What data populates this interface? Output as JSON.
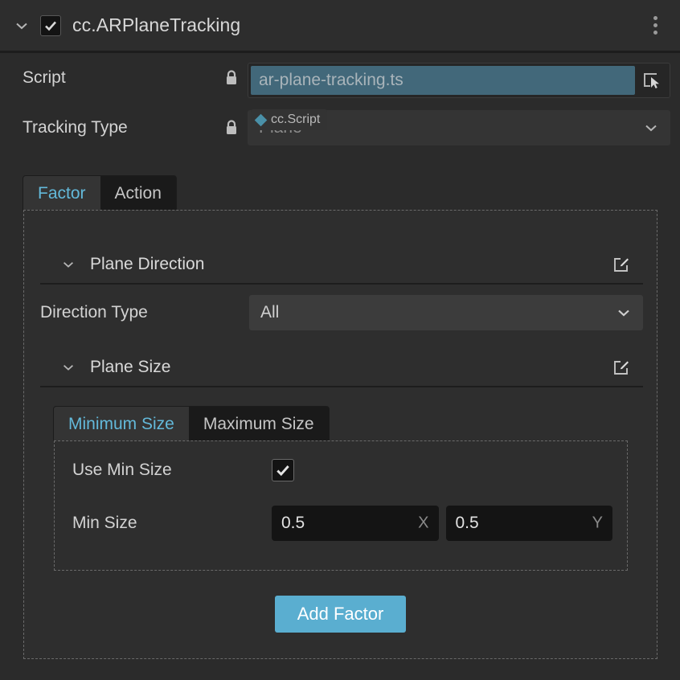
{
  "component": {
    "title": "cc.ARPlaneTracking",
    "enabled_checkbox": "checked",
    "collapse_icon": "chevron-down-icon",
    "menu_icon": "kebab-menu-icon"
  },
  "properties": {
    "script": {
      "label": "Script",
      "lock_icon": "lock-icon",
      "value": "ar-plane-tracking.ts",
      "type_tag": "cc.Script",
      "type_tag_icon": "diamond-icon",
      "pick_icon": "select-node-icon"
    },
    "tracking_type": {
      "label": "Tracking Type",
      "lock_icon": "lock-icon",
      "value": "Plane",
      "caret_icon": "chevron-down-icon"
    }
  },
  "main_tabs": {
    "active": "Factor",
    "items": [
      {
        "label": "Factor",
        "active": true
      },
      {
        "label": "Action",
        "active": false
      }
    ]
  },
  "factor_panel": {
    "plane_direction": {
      "title": "Plane Direction",
      "collapse_icon": "chevron-down-icon",
      "edit_icon": "edit-square-icon",
      "direction_type": {
        "label": "Direction Type",
        "value": "All",
        "caret_icon": "chevron-down-icon"
      }
    },
    "plane_size": {
      "title": "Plane Size",
      "collapse_icon": "chevron-down-icon",
      "edit_icon": "edit-square-icon",
      "size_tabs": {
        "active": "Minimum Size",
        "items": [
          {
            "label": "Minimum Size",
            "active": true
          },
          {
            "label": "Maximum Size",
            "active": false
          }
        ]
      },
      "use_min_size": {
        "label": "Use Min Size",
        "checked": "checked"
      },
      "min_size": {
        "label": "Min Size",
        "x_value": "0.5",
        "x_axis": "X",
        "y_value": "0.5",
        "y_axis": "Y"
      }
    },
    "add_factor_button": "Add Factor"
  },
  "colors": {
    "panel_bg": "#2b2b2b",
    "accent_blue": "#5aaed0",
    "tab_active_text": "#63b9da",
    "script_field_bg": "#42687a",
    "field_bg": "#141414",
    "select_bg": "#3c3c3c"
  }
}
